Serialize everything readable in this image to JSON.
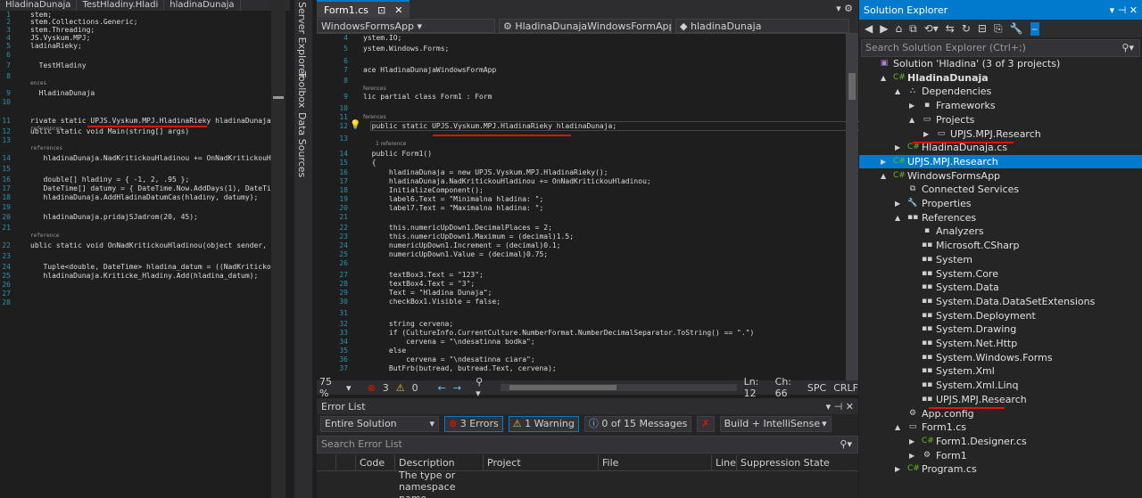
{
  "left_editor": {
    "tabs": [
      "HladinaDunaja",
      "TestHladiny.Hladi",
      "hladinaDunaja"
    ],
    "lines": [
      {
        "n": "1",
        "code": "stem;"
      },
      {
        "n": "2",
        "code": "stem.Collections.Generic;"
      },
      {
        "n": "3",
        "code": "stem.Threading;"
      },
      {
        "n": "4",
        "code": "JS.Vyskum.MPJ;"
      },
      {
        "n": "5",
        "code": "ladinaRieky;"
      },
      {
        "n": "6",
        "code": ""
      },
      {
        "n": "7",
        "code": "  TestHladiny"
      },
      {
        "n": "8",
        "code": ""
      },
      {
        "n": "9",
        "code": "  HladinaDunaja"
      },
      {
        "n": "10",
        "code": ""
      },
      {
        "n": "11",
        "code": "rivate static UPJS.Vyskum.MPJ.HladinaRieky hladinaDunaja ="
      },
      {
        "n": "12",
        "code": "ublic static void Main(string[] args)"
      },
      {
        "n": "13",
        "code": ""
      },
      {
        "n": "14",
        "code": "   hladinaDunaja.NadKritickouHladinou += OnNadKritickouHlad"
      },
      {
        "n": "15",
        "code": ""
      },
      {
        "n": "16",
        "code": "   double[] hladiny = { -1, 2, .95 };"
      },
      {
        "n": "17",
        "code": "   DateTime[] datumy = { DateTime.Now.AddDays(1), DateTime"
      },
      {
        "n": "18",
        "code": "   hladinaDunaja.AddHladinaDatumCas(hladiny, datumy);"
      },
      {
        "n": "19",
        "code": ""
      },
      {
        "n": "20",
        "code": "   hladinaDunaja.pridajSJadrom(20, 45);"
      },
      {
        "n": "21",
        "code": ""
      },
      {
        "n": "22",
        "code": "ublic static void OnNadKritickouHladinou(object sender, Eve"
      },
      {
        "n": "23",
        "code": ""
      },
      {
        "n": "24",
        "code": "   Tuple<double, DateTime> hladina_datum = ((NadKritickouHl"
      },
      {
        "n": "25",
        "code": "   hladinaDunaja.Kriticke_Hladiny.Add(hladina_datum);"
      },
      {
        "n": "26",
        "code": ""
      },
      {
        "n": "27",
        "code": ""
      },
      {
        "n": "28",
        "code": ""
      }
    ],
    "refs": [
      "ences",
      "references",
      "references",
      "reference"
    ]
  },
  "side_tabs": [
    "Server Explorer",
    "Toolbox",
    "Data Sources"
  ],
  "center": {
    "tab": "Form1.cs",
    "nav": [
      "WindowsFormsApp",
      "HladinaDunajaWindowsFormApp.For",
      "hladinaDunaja"
    ],
    "lines": [
      {
        "n": "4",
        "code": "ystem.IO;"
      },
      {
        "n": "5",
        "code": "ystem.Windows.Forms;"
      },
      {
        "n": "6",
        "code": ""
      },
      {
        "n": "7",
        "code": "ace HladinaDunajaWindowsFormApp"
      },
      {
        "n": "8",
        "code": ""
      },
      {
        "n": "9",
        "code": "lic partial class Form1 : Form"
      },
      {
        "n": "10",
        "code": ""
      },
      {
        "n": "11",
        "code": ""
      },
      {
        "n": "12",
        "code": "  public static UPJS.Vyskum.MPJ.HladinaRieky hladinaDunaja;"
      },
      {
        "n": "13",
        "code": ""
      },
      {
        "n": "14",
        "code": "  public Form1()"
      },
      {
        "n": "15",
        "code": "  {"
      },
      {
        "n": "16",
        "code": "      hladinaDunaja = new UPJS.Vyskum.MPJ.HladinaRieky();"
      },
      {
        "n": "17",
        "code": "      hladinaDunaja.NadKritickouHladinou += OnNadKritickouHladinou;"
      },
      {
        "n": "18",
        "code": "      InitializeComponent();"
      },
      {
        "n": "19",
        "code": "      label6.Text = \"Minimalna hladina: \";"
      },
      {
        "n": "20",
        "code": "      label7.Text = \"Maximalna hladina: \";"
      },
      {
        "n": "21",
        "code": ""
      },
      {
        "n": "22",
        "code": "      this.numericUpDown1.DecimalPlaces = 2;"
      },
      {
        "n": "23",
        "code": "      this.numericUpDown1.Maximum = (decimal)1.5;"
      },
      {
        "n": "24",
        "code": "      numericUpDown1.Increment = (decimal)0.1;"
      },
      {
        "n": "25",
        "code": "      numericUpDown1.Value = (decimal)0.75;"
      },
      {
        "n": "26",
        "code": ""
      },
      {
        "n": "27",
        "code": "      textBox3.Text = \"123\";"
      },
      {
        "n": "28",
        "code": "      textBox4.Text = \"3\";"
      },
      {
        "n": "29",
        "code": "      Text = \"Hladina Dunaja\";"
      },
      {
        "n": "30",
        "code": "      checkBox1.Visible = false;"
      },
      {
        "n": "31",
        "code": ""
      },
      {
        "n": "32",
        "code": "      string cervena;"
      },
      {
        "n": "33",
        "code": "      if (CultureInfo.CurrentCulture.NumberFormat.NumberDecimalSeparator.ToString() == \".\")"
      },
      {
        "n": "34",
        "code": "          cervena = \"\\ndesatinna bodka\";"
      },
      {
        "n": "35",
        "code": "      else"
      },
      {
        "n": "36",
        "code": "          cervena = \"\\ndesatinna ciara\";"
      },
      {
        "n": "37",
        "code": "      ButFrb(butread, butread.Text, cervena);"
      }
    ],
    "refs": [
      "ferences",
      "ferences",
      "1 reference"
    ],
    "status": {
      "zoom": "75 %",
      "errors": "3",
      "warnings": "0",
      "ln": "Ln: 12",
      "ch": "Ch: 66",
      "spc": "SPC",
      "crlf": "CRLF"
    }
  },
  "error_list": {
    "title": "Error List",
    "scope": "Entire Solution",
    "errors": "3 Errors",
    "warnings": "1 Warning",
    "messages": "0 of 15 Messages",
    "build": "Build + IntelliSense",
    "search_placeholder": "Search Error List",
    "columns": [
      "Code",
      "Description",
      "Project",
      "File",
      "Line",
      "Suppression State"
    ],
    "row_desc": "The type or namespace name"
  },
  "solution_explorer": {
    "title": "Solution Explorer",
    "search_placeholder": "Search Solution Explorer (Ctrl+;)",
    "items": [
      {
        "label": "Solution 'Hladina' (3 of 3 projects)",
        "indent": 0,
        "arrow": "",
        "icon": "solution-icon"
      },
      {
        "label": "HladinaDunaja",
        "indent": 1,
        "arrow": "▲",
        "icon": "csharp-project-icon",
        "bold": true
      },
      {
        "label": "Dependencies",
        "indent": 2,
        "arrow": "▲",
        "icon": "dependencies-icon"
      },
      {
        "label": "Frameworks",
        "indent": 3,
        "arrow": "▶",
        "icon": "frameworks-icon"
      },
      {
        "label": "Projects",
        "indent": 3,
        "arrow": "▲",
        "icon": "projects-icon"
      },
      {
        "label": "UPJS.MPJ.Research",
        "indent": 4,
        "arrow": "▶",
        "icon": "project-ref-icon"
      },
      {
        "label": "HladinaDunaja.cs",
        "indent": 2,
        "arrow": "▶",
        "icon": "csharp-file-icon"
      },
      {
        "label": "UPJS.MPJ.Research",
        "indent": 1,
        "arrow": "▶",
        "icon": "csharp-project-icon",
        "selected": true
      },
      {
        "label": "WindowsFormsApp",
        "indent": 1,
        "arrow": "▲",
        "icon": "csharp-project-icon"
      },
      {
        "label": "Connected Services",
        "indent": 2,
        "arrow": "",
        "icon": "connected-services-icon"
      },
      {
        "label": "Properties",
        "indent": 2,
        "arrow": "▶",
        "icon": "properties-icon"
      },
      {
        "label": "References",
        "indent": 2,
        "arrow": "▲",
        "icon": "references-icon"
      },
      {
        "label": "Analyzers",
        "indent": 3,
        "arrow": "",
        "icon": "analyzers-icon"
      },
      {
        "label": "Microsoft.CSharp",
        "indent": 3,
        "arrow": "",
        "icon": "reference-icon"
      },
      {
        "label": "System",
        "indent": 3,
        "arrow": "",
        "icon": "reference-icon"
      },
      {
        "label": "System.Core",
        "indent": 3,
        "arrow": "",
        "icon": "reference-icon"
      },
      {
        "label": "System.Data",
        "indent": 3,
        "arrow": "",
        "icon": "reference-icon"
      },
      {
        "label": "System.Data.DataSetExtensions",
        "indent": 3,
        "arrow": "",
        "icon": "reference-icon"
      },
      {
        "label": "System.Deployment",
        "indent": 3,
        "arrow": "",
        "icon": "reference-icon"
      },
      {
        "label": "System.Drawing",
        "indent": 3,
        "arrow": "",
        "icon": "reference-icon"
      },
      {
        "label": "System.Net.Http",
        "indent": 3,
        "arrow": "",
        "icon": "reference-icon"
      },
      {
        "label": "System.Windows.Forms",
        "indent": 3,
        "arrow": "",
        "icon": "reference-icon"
      },
      {
        "label": "System.Xml",
        "indent": 3,
        "arrow": "",
        "icon": "reference-icon"
      },
      {
        "label": "System.Xml.Linq",
        "indent": 3,
        "arrow": "",
        "icon": "reference-icon"
      },
      {
        "label": "UPJS.MPJ.Research",
        "indent": 3,
        "arrow": "",
        "icon": "reference-icon"
      },
      {
        "label": "App.config",
        "indent": 2,
        "arrow": "",
        "icon": "config-icon"
      },
      {
        "label": "Form1.cs",
        "indent": 2,
        "arrow": "▲",
        "icon": "form-icon"
      },
      {
        "label": "Form1.Designer.cs",
        "indent": 3,
        "arrow": "▶",
        "icon": "csharp-file-icon"
      },
      {
        "label": "Form1",
        "indent": 3,
        "arrow": "▶",
        "icon": "form-class-icon"
      },
      {
        "label": "Program.cs",
        "indent": 2,
        "arrow": "▶",
        "icon": "csharp-file-icon"
      }
    ]
  },
  "colors": {
    "accent": "#007acc",
    "underline": "#e51400"
  }
}
